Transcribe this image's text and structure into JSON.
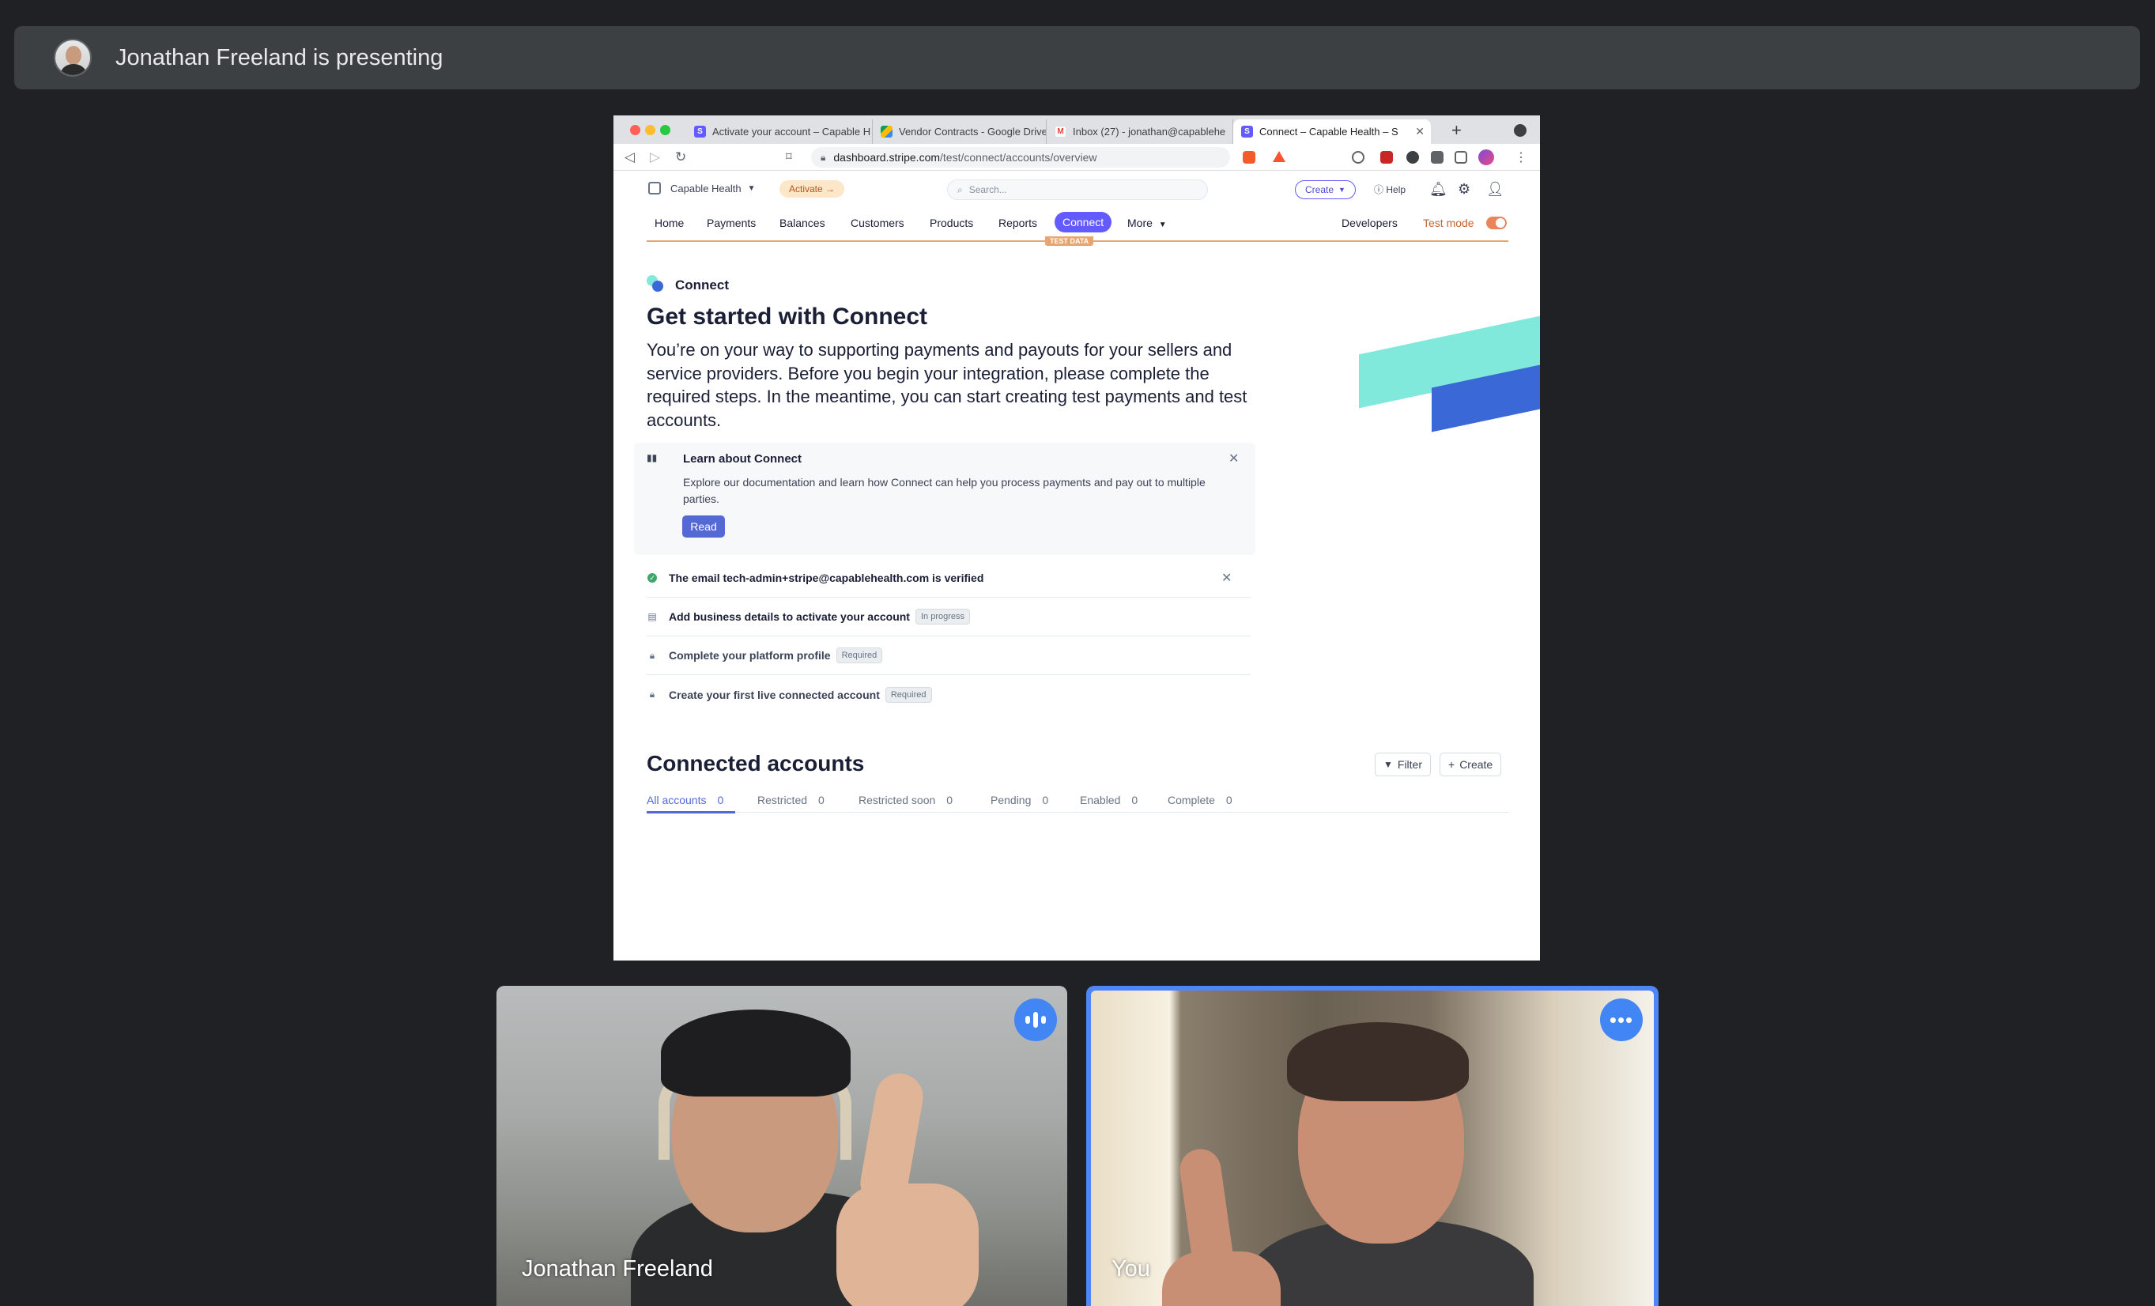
{
  "meet": {
    "presenting_text": "Jonathan Freeland is presenting",
    "participants": [
      {
        "name": "Jonathan Freeland"
      },
      {
        "name": "You"
      }
    ]
  },
  "browser": {
    "tabs": [
      {
        "label": "Activate your account – Capable H",
        "icon": "stripe-icon",
        "active": false
      },
      {
        "label": "Vendor Contracts - Google Drive",
        "icon": "google-drive-icon",
        "active": false
      },
      {
        "label": "Inbox (27) - jonathan@capablehe",
        "icon": "gmail-icon",
        "active": false
      },
      {
        "label": "Connect – Capable Health – S",
        "icon": "stripe-icon",
        "active": true
      }
    ],
    "new_tab_label": "+",
    "url_domain": "dashboard.stripe.com",
    "url_path": "/test/connect/accounts/overview"
  },
  "stripe": {
    "account_name": "Capable Health",
    "activate_label": "Activate →",
    "search_placeholder": "Search...",
    "create_label": "Create",
    "help_label": "Help",
    "nav": {
      "items": [
        "Home",
        "Payments",
        "Balances",
        "Customers",
        "Products",
        "Reports",
        "Connect",
        "More"
      ],
      "developers": "Developers",
      "test_mode": "Test mode",
      "test_data_badge": "TEST DATA",
      "active": "Connect"
    },
    "connect_label": "Connect",
    "heading": "Get started with Connect",
    "intro": "You’re on your way to supporting payments and payouts for your sellers and service providers. Before you begin your integration, please complete the required steps. In the meantime, you can start creating test payments and test accounts.",
    "learn": {
      "title": "Learn about Connect",
      "description": "Explore our documentation and learn how Connect can help you process payments and pay out to multiple parties.",
      "button": "Read"
    },
    "steps": [
      {
        "text": "The email tech-admin+stripe@capablehealth.com is verified",
        "status": ""
      },
      {
        "text": "Add business details to activate your account",
        "status": "In progress"
      },
      {
        "text": "Complete your platform profile",
        "status": "Required"
      },
      {
        "text": "Create your first live connected account",
        "status": "Required"
      }
    ],
    "connected_accounts": {
      "title": "Connected accounts",
      "filter_label": "Filter",
      "create_label": "Create",
      "tabs": [
        {
          "label": "All accounts",
          "count": "0"
        },
        {
          "label": "Restricted",
          "count": "0"
        },
        {
          "label": "Restricted soon",
          "count": "0"
        },
        {
          "label": "Pending",
          "count": "0"
        },
        {
          "label": "Enabled",
          "count": "0"
        },
        {
          "label": "Complete",
          "count": "0"
        }
      ]
    }
  },
  "colors": {
    "meet_bg": "#202124",
    "stripe_accent": "#635bff",
    "test_mode_orange": "#e8a56f",
    "meet_blue": "#4285f4"
  }
}
